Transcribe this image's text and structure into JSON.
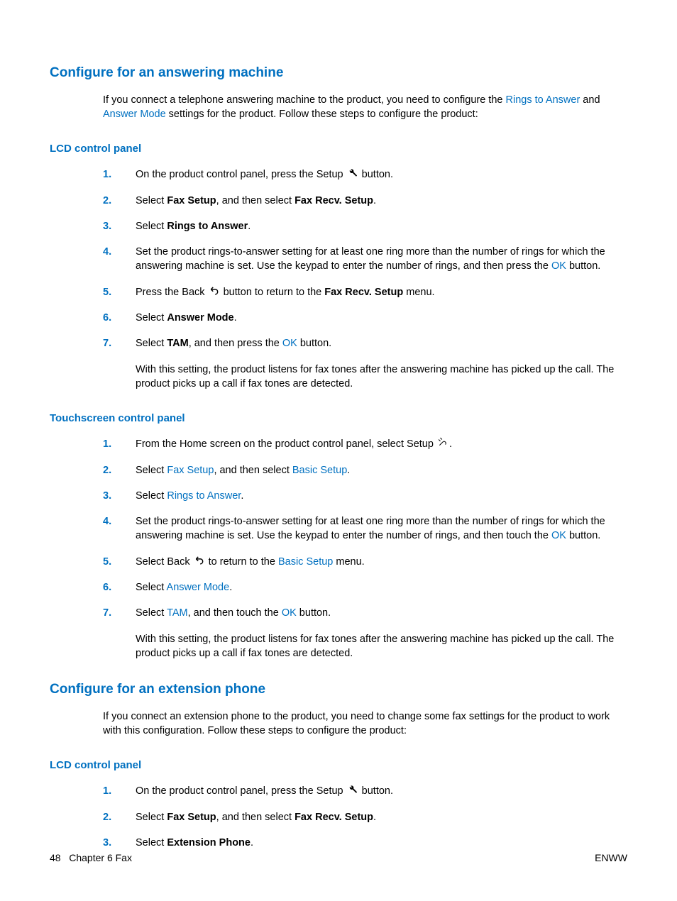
{
  "section1": {
    "title": "Configure for an answering machine",
    "intro_pre": "If you connect a telephone answering machine to the product, you need to configure the ",
    "intro_link1": "Rings to Answer",
    "intro_mid": " and ",
    "intro_link2": "Answer Mode",
    "intro_post": " settings for the product. Follow these steps to configure the product:",
    "lcd": {
      "heading": "LCD control panel",
      "s1_pre": "On the product control panel, press the Setup ",
      "s1_post": " button.",
      "s2_a": "Select ",
      "s2_b": "Fax Setup",
      "s2_c": ", and then select ",
      "s2_d": "Fax Recv. Setup",
      "s2_e": ".",
      "s3_a": "Select ",
      "s3_b": "Rings to Answer",
      "s3_c": ".",
      "s4_a": "Set the product rings-to-answer setting for at least one ring more than the number of rings for which the answering machine is set. Use the keypad to enter the number of rings, and then press the ",
      "s4_b": "OK",
      "s4_c": " button.",
      "s5_a": "Press the Back ",
      "s5_b": " button to return to the ",
      "s5_c": "Fax Recv. Setup",
      "s5_d": " menu.",
      "s6_a": "Select ",
      "s6_b": "Answer Mode",
      "s6_c": ".",
      "s7_a": "Select ",
      "s7_b": "TAM",
      "s7_c": ", and then press the ",
      "s7_d": "OK",
      "s7_e": " button.",
      "note": "With this setting, the product listens for fax tones after the answering machine has picked up the call. The product picks up a call if fax tones are detected."
    },
    "touch": {
      "heading": "Touchscreen control panel",
      "s1_pre": "From the Home screen on the product control panel, select Setup ",
      "s1_post": ".",
      "s2_a": "Select ",
      "s2_b": "Fax Setup",
      "s2_c": ", and then select ",
      "s2_d": "Basic Setup",
      "s2_e": ".",
      "s3_a": "Select ",
      "s3_b": "Rings to Answer",
      "s3_c": ".",
      "s4_a": "Set the product rings-to-answer setting for at least one ring more than the number of rings for which the answering machine is set. Use the keypad to enter the number of rings, and then touch the ",
      "s4_b": "OK",
      "s4_c": " button.",
      "s5_a": "Select Back ",
      "s5_b": " to return to the ",
      "s5_c": "Basic Setup",
      "s5_d": " menu.",
      "s6_a": "Select ",
      "s6_b": "Answer Mode",
      "s6_c": ".",
      "s7_a": "Select ",
      "s7_b": "TAM",
      "s7_c": ", and then touch the ",
      "s7_d": "OK",
      "s7_e": " button.",
      "note": "With this setting, the product listens for fax tones after the answering machine has picked up the call. The product picks up a call if fax tones are detected."
    }
  },
  "section2": {
    "title": "Configure for an extension phone",
    "intro": "If you connect an extension phone to the product, you need to change some fax settings for the product to work with this configuration. Follow these steps to configure the product:",
    "lcd": {
      "heading": "LCD control panel",
      "s1_pre": "On the product control panel, press the Setup ",
      "s1_post": " button.",
      "s2_a": "Select ",
      "s2_b": "Fax Setup",
      "s2_c": ", and then select ",
      "s2_d": "Fax Recv. Setup",
      "s2_e": ".",
      "s3_a": "Select ",
      "s3_b": "Extension Phone",
      "s3_c": "."
    }
  },
  "nums": {
    "n1": "1.",
    "n2": "2.",
    "n3": "3.",
    "n4": "4.",
    "n5": "5.",
    "n6": "6.",
    "n7": "7."
  },
  "footer": {
    "page": "48",
    "chapter": "Chapter 6   Fax",
    "right": "ENWW"
  }
}
